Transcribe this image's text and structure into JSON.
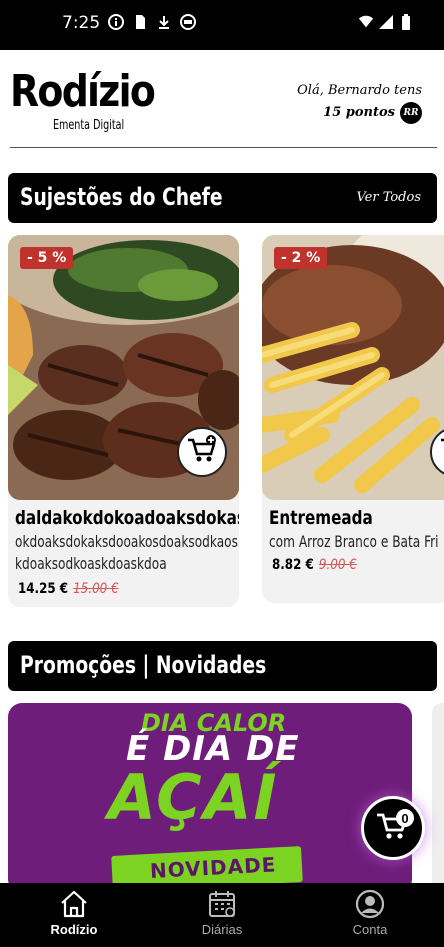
{
  "status_bar": {
    "time": "7:25"
  },
  "header": {
    "brand": "Rodízio",
    "subtitle": "Ementa Digital",
    "greeting": "Olá, Bernardo tens",
    "points": "15 pontos",
    "points_badge": "RR"
  },
  "chef_section": {
    "title": "Sujestões do Chefe",
    "link": "Ver Todos"
  },
  "products": [
    {
      "name": "daldakokdokoadoaksdokasd",
      "description": "okdoaksdokaksdooakosdoaksodkaoskdoaksodkoaskdoaskdoa",
      "discount": "- 5 %",
      "price": "14.25 €",
      "old_price": "15.00 €"
    },
    {
      "name": "Entremeada",
      "description": "com Arroz Branco e Bata Fri",
      "discount": "- 2 %",
      "price": "8.82 €",
      "old_price": "9.00 €"
    }
  ],
  "promo_section": {
    "title": "Promoções | Novidades"
  },
  "promo_banner": {
    "line1": "DIA CALOR",
    "line2": "É DIA DE",
    "line3": "AÇAÍ",
    "tag": "NOVIDADE"
  },
  "cart": {
    "count": "0"
  },
  "nav": [
    {
      "label": "Rodízio",
      "icon": "home-icon",
      "active": true
    },
    {
      "label": "Diárias",
      "icon": "calendar-icon",
      "active": false
    },
    {
      "label": "Conta",
      "icon": "account-icon",
      "active": false
    }
  ],
  "colors": {
    "discount": "#c0322c",
    "promo_bg": "#6e1d7a",
    "promo_green": "#7dd321"
  }
}
